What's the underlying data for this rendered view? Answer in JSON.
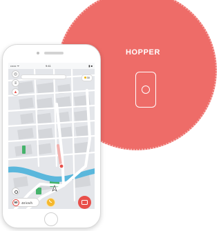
{
  "promo": {
    "title": "HOPPER",
    "icon": "device-icon"
  },
  "phone": {
    "status_bar": {
      "carrier": "•••••• ᯤ",
      "time": "9:41",
      "battery": "▮ ■"
    },
    "map": {
      "controls": [
        {
          "name": "layers-icon",
          "glyph": "◎"
        },
        {
          "name": "filter-icon",
          "glyph": "≡"
        },
        {
          "name": "compass-icon",
          "glyph": "▲"
        }
      ],
      "badge": "30"
    },
    "speed": {
      "limit": "50",
      "current": "48 km/h"
    },
    "colors": {
      "accent": "#e84f4a",
      "gauge": "#f5b82d",
      "route": "#ffffff",
      "river": "#5ab7dc",
      "park": "#45b36b"
    }
  }
}
